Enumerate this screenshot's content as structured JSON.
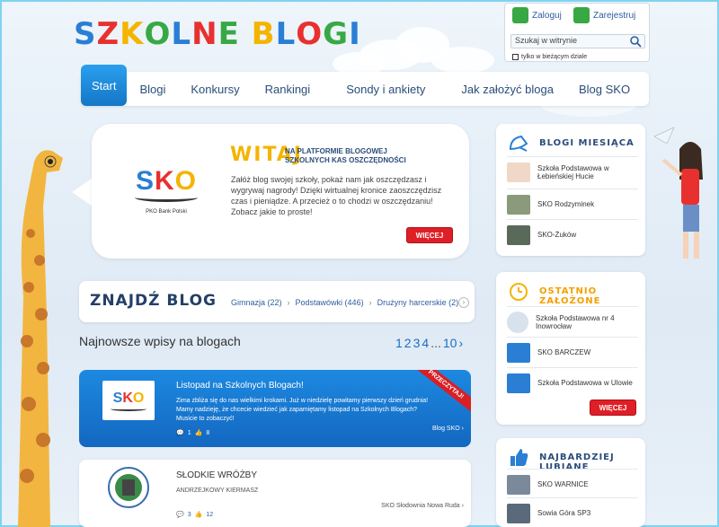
{
  "logo": {
    "letters": [
      "S",
      "Z",
      "K",
      "O",
      "L",
      "N",
      "E",
      " ",
      "B",
      "L",
      "O",
      "G",
      "I"
    ],
    "colors": [
      "#2a7fd4",
      "#e8312f",
      "#f4b400",
      "#38a845",
      "#2a7fd4",
      "#e8312f",
      "#38a845",
      "#ffffff",
      "#f4b400",
      "#2a7fd4",
      "#e8312f",
      "#38a845",
      "#2a7fd4"
    ]
  },
  "user": {
    "login": "Zaloguj",
    "register": "Zarejestruj"
  },
  "search": {
    "placeholder": "Szukaj w witrynie",
    "scope": "tylko w bieżącym dziale"
  },
  "nav": {
    "items": [
      "Start",
      "Blogi",
      "Konkursy",
      "Rankingi",
      "Sondy i ankiety",
      "Jak założyć bloga",
      "Blog SKO"
    ]
  },
  "welcome": {
    "title": "WITAJ",
    "subtitle": "NA PLATFORMIE BLOGOWEJ SZKOLNYCH KAS OSZCZĘDNOŚCI",
    "text": "Załóż blog swojej szkoły, pokaż nam jak oszczędzasz i wygrywaj nagrody! Dzięki wirtualnej kronice zaoszczędzisz czas i pieniądze. A przecież o to chodzi w oszczędzaniu! Zobacz jakie to proste!",
    "button": "WIĘCEJ",
    "logo_text": "SKO",
    "logo_small": "PKO Bank Polski"
  },
  "find": {
    "title": "ZNAJDŹ BLOG",
    "links": [
      "Gimnazja (22)",
      "Podstawówki (446)",
      "Drużyny harcerskie (2)"
    ]
  },
  "latest": {
    "title": "Najnowsze wpisy na blogach",
    "pager": [
      "1",
      "2",
      "3",
      "4",
      "...",
      "10",
      "›"
    ]
  },
  "posts": [
    {
      "title": "Listopad na Szkolnych Blogach!",
      "excerpt": "Zima zbliża się do nas wielkimi krokami. Już w niedzielę powitamy pierwszy dzień grudnia! Mamy nadzieję, że chcecie wiedzieć jak zapamiętamy listopad na Szkolnych Blogach? Musicie to zobaczyć!",
      "comments": "1",
      "likes": "8",
      "source": "Blog SKO",
      "ribbon": "PRZECZYTAJ!",
      "thumb_text": "SKO"
    },
    {
      "title": "SŁODKIE WRÓŻBY",
      "excerpt": "ANDRZEJKOWY KIERMASZ",
      "comments": "3",
      "likes": "12",
      "source": "SKO Słodownia Nowa Ruda"
    }
  ],
  "sidebar": {
    "blogs_month": {
      "title": "BLOGI MIESIĄCA",
      "items": [
        "Szkoła Podstawowa w Łebieńskiej Hucie",
        "SKO Rodzyminek",
        "SKO-Żuków"
      ]
    },
    "recent": {
      "title": "OSTATNIO ZAŁOŻONE",
      "items": [
        "Szkoła Podstawowa nr 4 Inowrocław",
        "SKO BARCZEW",
        "Szkoła Podstawowa w Ulowie"
      ],
      "button": "WIĘCEJ"
    },
    "liked": {
      "title": "NAJBARDZIEJ LUBIANE",
      "items": [
        "SKO WARNICE",
        "Sowia Góra SP3"
      ]
    }
  },
  "colors": {
    "accent": "#1a8fe0",
    "red": "#e01e26",
    "navy": "#243f68"
  }
}
